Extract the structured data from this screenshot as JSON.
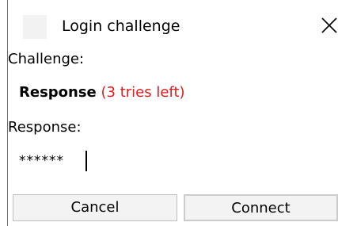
{
  "window": {
    "title": "Login challenge",
    "close_icon": "close-icon"
  },
  "form": {
    "challenge_label": "Challenge:",
    "response_heading": "Response",
    "tries_left": "(3 tries left)",
    "response_label": "Response:",
    "password_value": "******"
  },
  "buttons": {
    "cancel_label": "Cancel",
    "connect_label": "Connect"
  },
  "colors": {
    "tries_text": "#e01c1c",
    "button_bg": "#f3f3f3",
    "button_border": "#bdbdbd"
  }
}
